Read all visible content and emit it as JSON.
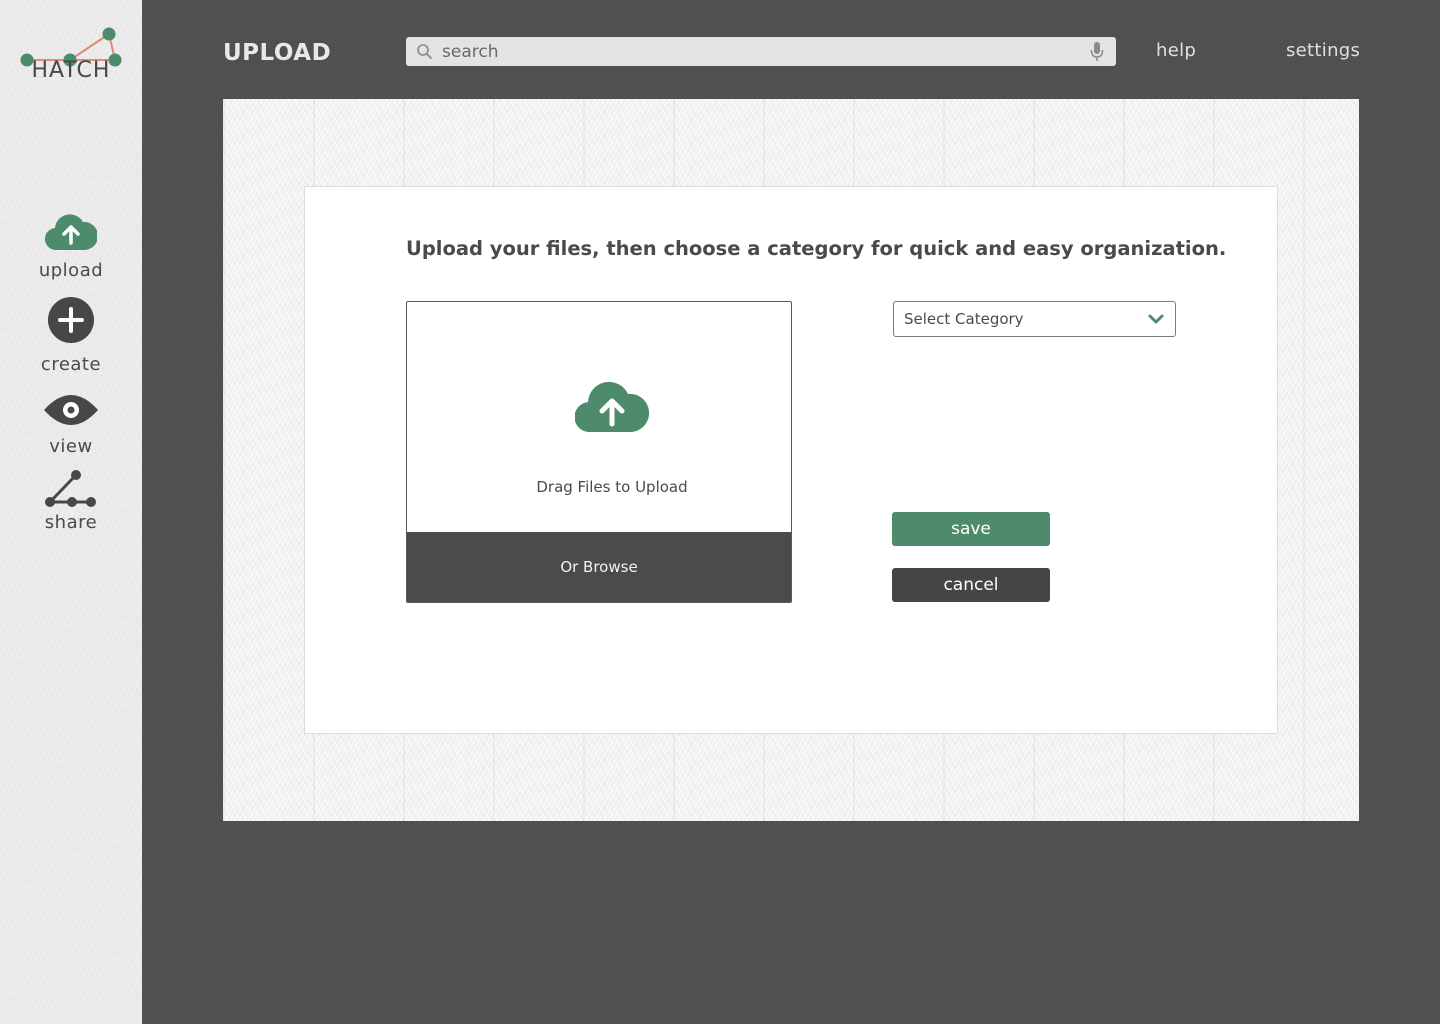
{
  "brand": {
    "name": "HATCH",
    "accent_color": "#4e8a6c",
    "line_color": "#e08a7a"
  },
  "sidebar": {
    "items": [
      {
        "label": "upload",
        "icon": "cloud-upload-icon"
      },
      {
        "label": "create",
        "icon": "plus-circle-icon"
      },
      {
        "label": "view",
        "icon": "eye-icon"
      },
      {
        "label": "share",
        "icon": "share-nodes-icon"
      }
    ]
  },
  "header": {
    "title": "UPLOAD",
    "search": {
      "placeholder": "search",
      "icon": "search-icon",
      "voice_icon": "microphone-icon"
    },
    "links": [
      "help",
      "settings"
    ]
  },
  "main": {
    "headline": "Upload your files, then choose a category for quick and easy organization.",
    "dropzone": {
      "icon": "cloud-upload-icon",
      "label": "Drag Files to Upload",
      "browse_label": "Or Browse"
    },
    "category_select": {
      "value": "Select Category",
      "icon": "chevron-down-icon"
    },
    "save_label": "save",
    "cancel_label": "cancel"
  },
  "colors": {
    "background": "#505050",
    "save_button": "#4e8a6c",
    "cancel_button": "#454545",
    "browse_bar": "#4b4b4b"
  }
}
